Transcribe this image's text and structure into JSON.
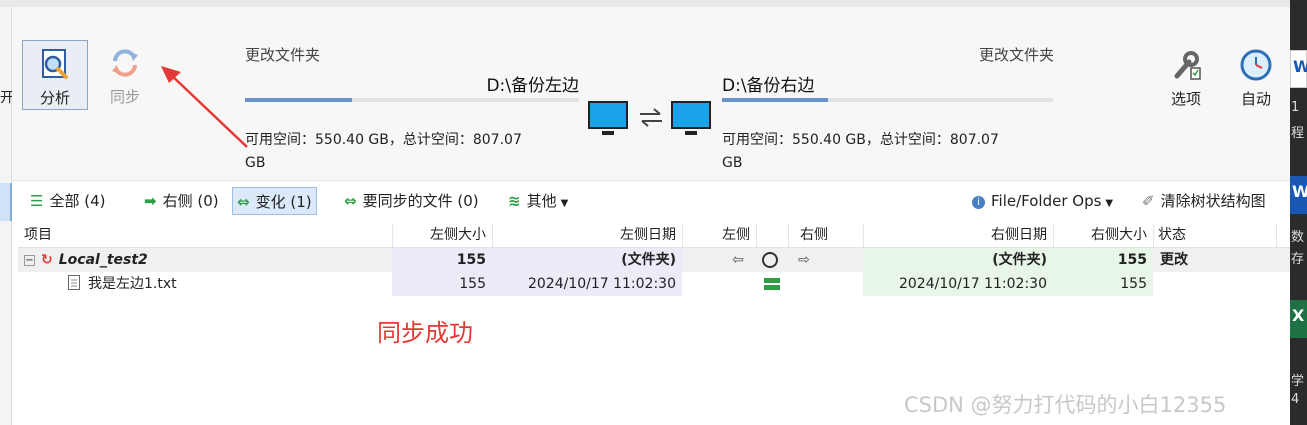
{
  "left_pane": {
    "partial_text": "开"
  },
  "toolbar": {
    "analyze_label": "分析",
    "sync_label": "同步",
    "options_label": "选项",
    "auto_label": "自动"
  },
  "left_folder": {
    "label": "更改文件夹",
    "path": "D:\\备份左边",
    "space_line1": "可用空间：550.40 GB，总计空间：807.07",
    "space_line2": "GB",
    "progress": 0.32
  },
  "right_folder": {
    "label": "更改文件夹",
    "path": "D:\\备份右边",
    "space_line1": "可用空间：550.40 GB，总计空间：807.07",
    "space_line2": "GB",
    "progress": 0.32
  },
  "filters": {
    "all": "全部 (4)",
    "right": "右侧 (0)",
    "changed": "变化 (1)",
    "to_sync": "要同步的文件 (0)",
    "other": "其他",
    "file_ops": "File/Folder Ops",
    "clear_tree": "清除树状结构图"
  },
  "columns": {
    "item": "项目",
    "left_size": "左侧大小",
    "left_date": "左侧日期",
    "left": "左侧",
    "right": "右侧",
    "right_date": "右侧日期",
    "right_size": "右侧大小",
    "status": "状态"
  },
  "rows": [
    {
      "name": "Local_test2",
      "left_size": "155",
      "left_date": "(文件夹)",
      "right_date": "(文件夹)",
      "right_size": "155",
      "status": "更改"
    },
    {
      "name": "我是左边1.txt",
      "left_size": "155",
      "left_date": "2024/10/17 11:02:30",
      "right_date": "2024/10/17 11:02:30",
      "right_size": "155",
      "status": ""
    }
  ],
  "annotation": {
    "text": "同步成功",
    "color": "#e53935"
  },
  "watermark": "CSDN @努力打代码的小白12355",
  "right_strip": {
    "t1": "1",
    "t2": "程",
    "t3": "数",
    "t4": "存",
    "t5": "学",
    "t6": "4"
  },
  "colors": {
    "accent": "#6a94c9",
    "sync_green": "#2f9e44",
    "success_red": "#e53935"
  }
}
